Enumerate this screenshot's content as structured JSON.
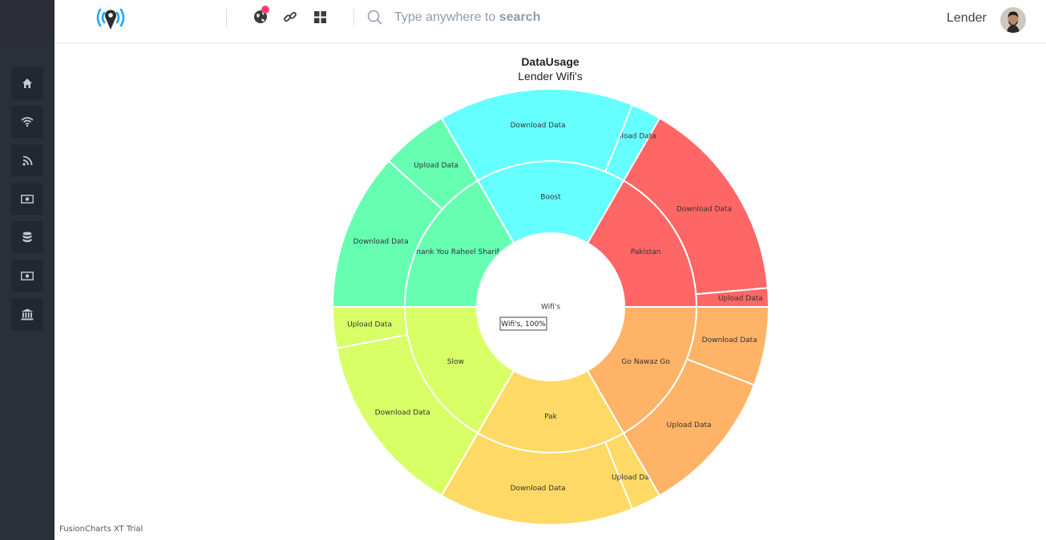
{
  "header": {
    "user_name": "Lender",
    "search": {
      "placeholder_prefix": "Type anywhere to ",
      "placeholder_bold": "search"
    },
    "icons": [
      "globe-icon",
      "link-icon",
      "grid-icon",
      "search-icon"
    ],
    "logo": "location-signal-logo"
  },
  "sidebar": {
    "items": [
      {
        "icon": "home-icon"
      },
      {
        "icon": "wifi-icon"
      },
      {
        "icon": "rss-icon"
      },
      {
        "icon": "money-icon"
      },
      {
        "icon": "database-icon"
      },
      {
        "icon": "money-icon"
      },
      {
        "icon": "bank-icon"
      }
    ]
  },
  "chart_data": {
    "type": "sunburst",
    "title": "DataUsage",
    "subtitle": "Lender Wifi's",
    "root": {
      "label": "Wifi's",
      "tooltip": "Wifi's, 100%"
    },
    "nodes": [
      {
        "label": "Pakistan",
        "color": "#ff6666",
        "start": 0,
        "end": 60,
        "children": [
          {
            "label": "Upload Data",
            "start": 0,
            "end": 5
          },
          {
            "label": "Download Data",
            "start": 5,
            "end": 60
          }
        ]
      },
      {
        "label": "Boost",
        "color": "#66ffff",
        "start": 60,
        "end": 120,
        "children": [
          {
            "label": "Upload Data",
            "start": 60,
            "end": 68
          },
          {
            "label": "Download Data",
            "start": 68,
            "end": 120
          }
        ]
      },
      {
        "label": "Thank You Raheel Sharif",
        "color": "#66ffb2",
        "start": 120,
        "end": 180,
        "children": [
          {
            "label": "Upload Data",
            "start": 120,
            "end": 138
          },
          {
            "label": "Download Data",
            "start": 138,
            "end": 180
          }
        ]
      },
      {
        "label": "Slow",
        "color": "#d9ff66",
        "start": 180,
        "end": 240,
        "children": [
          {
            "label": "Upload Data",
            "start": 180,
            "end": 191
          },
          {
            "label": "Download Data",
            "start": 191,
            "end": 240
          }
        ]
      },
      {
        "label": "Pak",
        "color": "#ffd966",
        "start": 240,
        "end": 300,
        "children": [
          {
            "label": "Download Data",
            "start": 240,
            "end": 292
          },
          {
            "label": "Upload Data",
            "start": 292,
            "end": 300
          }
        ]
      },
      {
        "label": "Go Nawaz Go",
        "color": "#ffb366",
        "start": 300,
        "end": 360,
        "children": [
          {
            "label": "Upload Data",
            "start": 300,
            "end": 339
          },
          {
            "label": "Download Data",
            "start": 339,
            "end": 360
          }
        ]
      }
    ]
  },
  "footer": {
    "trial_text": "FusionCharts XT Trial"
  },
  "colors": {
    "sidebar": "#2b2f3a",
    "accent": "#1ea7fd",
    "badge": "#ff3d71"
  }
}
